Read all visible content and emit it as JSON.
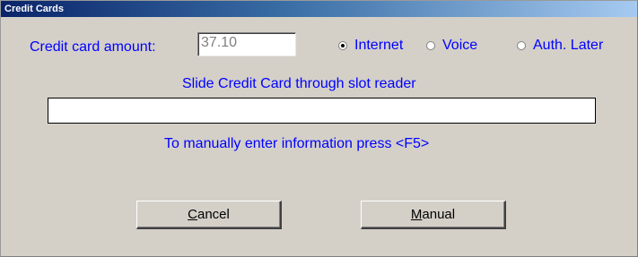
{
  "window": {
    "title": "Credit Cards"
  },
  "amount": {
    "label": "Credit card amount:",
    "value": "37.10"
  },
  "auth_method": {
    "selected": "Internet",
    "options": [
      "Internet",
      "Voice",
      "Auth. Later"
    ]
  },
  "swipe": {
    "instruction": "Slide Credit Card through slot reader",
    "value": ""
  },
  "manual_hint": "To manually enter information press <F5>",
  "buttons": {
    "cancel": {
      "mnemonic": "C",
      "rest": "ancel"
    },
    "manual": {
      "mnemonic": "M",
      "rest": "anual"
    }
  },
  "colors": {
    "label_text": "#0000ff",
    "face": "#d4d0c8",
    "title_start": "#0a246a",
    "title_end": "#a6caf0"
  }
}
